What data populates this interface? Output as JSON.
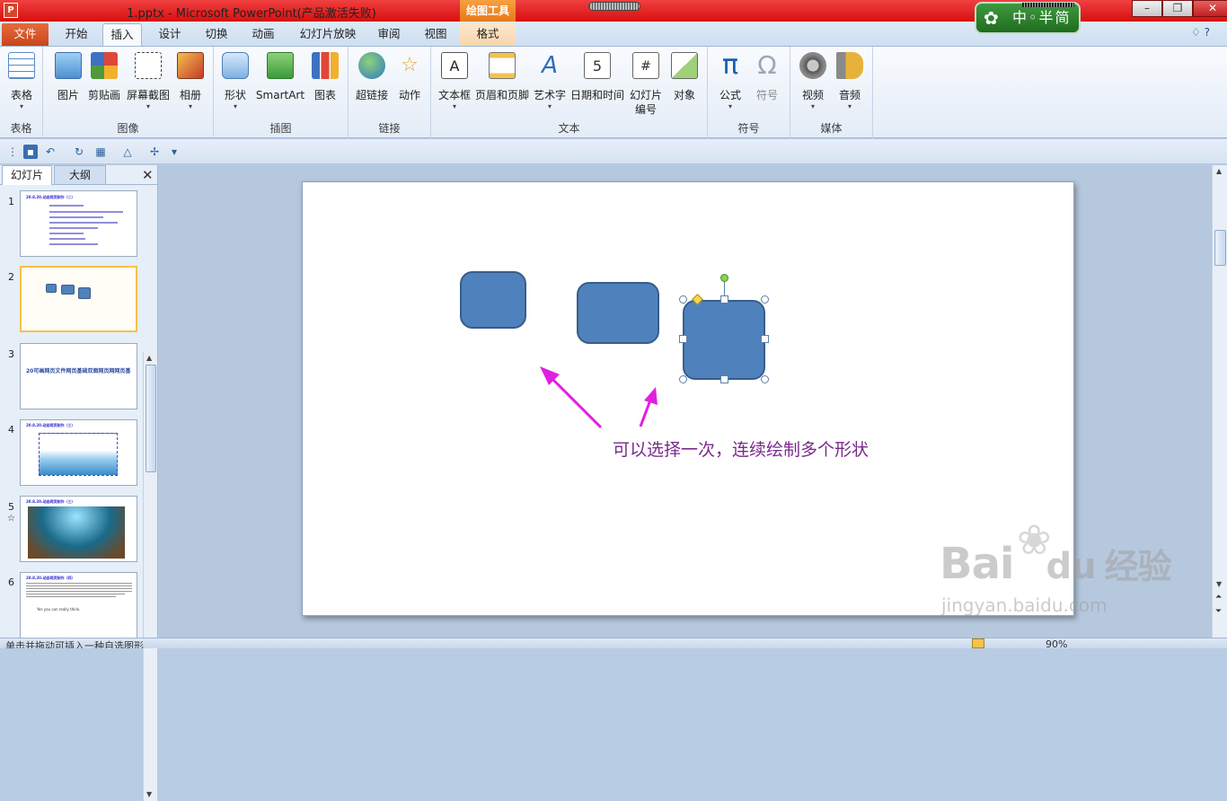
{
  "titlebar": {
    "app_icon": "P",
    "title": "1.pptx - Microsoft PowerPoint(产品激活失败)",
    "context_group": "绘图工具",
    "min": "–",
    "max": "❐",
    "close": "✕"
  },
  "ime": {
    "flower": "✿",
    "label": "中◦半简"
  },
  "tabs": [
    {
      "label": "文件"
    },
    {
      "label": "开始"
    },
    {
      "label": "插入"
    },
    {
      "label": "设计"
    },
    {
      "label": "切换"
    },
    {
      "label": "动画"
    },
    {
      "label": "幻灯片放映"
    },
    {
      "label": "审阅"
    },
    {
      "label": "视图"
    },
    {
      "label": "格式"
    }
  ],
  "ribbon_help": "♢ ?",
  "ribbon": {
    "groups": {
      "table": "表格",
      "images": "图像",
      "illustrations": "插图",
      "links": "链接",
      "text": "文本",
      "symbols": "符号",
      "media": "媒体"
    },
    "buttons": {
      "table": "表格",
      "picture": "图片",
      "clipart": "剪贴画",
      "screenshot": "屏幕截图",
      "album": "相册",
      "shapes": "形状",
      "smartart": "SmartArt",
      "chart": "图表",
      "hyperlink": "超链接",
      "action": "动作",
      "textbox": "文本框",
      "header_footer": "页眉和页脚",
      "wordart": "艺术字",
      "datetime": "日期和时间",
      "slide_number_1": "幻灯片",
      "slide_number_2": "编号",
      "object": "对象",
      "equation": "公式",
      "symbol": "符号",
      "video": "视频",
      "audio": "音频"
    },
    "icons": {
      "pi": "π",
      "omega": "Ω",
      "wordart": "A",
      "calendar": "5",
      "hash": "#"
    }
  },
  "pane": {
    "tab_slides": "幻灯片",
    "tab_outline": "大纲",
    "close": "✕"
  },
  "slides": [
    {
      "num": "1",
      "title": "20.8.20.动态网页制作（二）"
    },
    {
      "num": "2"
    },
    {
      "num": "3",
      "title": "20可画网页文件网页基础双面网页网网页基"
    },
    {
      "num": "4",
      "title": "20.8.20.动态网页制作（三）"
    },
    {
      "num": "5",
      "title": "20.8.20.动态网页制作（三）",
      "star": "☆"
    },
    {
      "num": "6",
      "title": "20.8.20.动态网页制作（四）",
      "body": "Yes you can really think."
    }
  ],
  "caption": "可以选择一次，连续绘制多个形状",
  "status": {
    "left": "单击并拖动可插入一种自选图形",
    "zoom": "90%"
  },
  "colors": {
    "shape_fill": "#4f81bd",
    "shape_border": "#385d8a",
    "arrow": "#e020e0",
    "caption": "#7a2a8a",
    "titlebar": "#e01818"
  },
  "watermark": {
    "brand": "Bai",
    "brand2": "du",
    "brand_cn": "经验",
    "url": "jingyan.baidu.com"
  }
}
